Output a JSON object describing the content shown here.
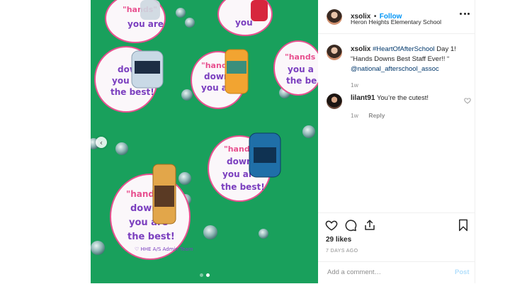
{
  "post": {
    "author": "xsolix",
    "follow_label": "Follow",
    "separator": "•",
    "location": "Heron Heights Elementary School",
    "caption": {
      "username": "xsolix",
      "hashtag": "#HeartOfAfterSchool",
      "text_1": "Day 1!",
      "text_2": "“Hands Downs Best Staff Ever!! “",
      "mention": "@national_afterschool_assoc",
      "time": "1w"
    },
    "comments": [
      {
        "username": "lilant91",
        "text": "You’re the cutest!",
        "time": "1w",
        "reply_label": "Reply"
      }
    ],
    "likes": "29 likes",
    "date": "7 DAYS AGO",
    "comment_placeholder": "Add a comment…",
    "post_label": "Post"
  },
  "carousel": {
    "current": 2,
    "total": 2
  },
  "photo": {
    "card_texts": [
      "\"hands\"",
      "down",
      "you are",
      "the best!"
    ],
    "card_signature": "♡ HHE A/S Admin Team"
  },
  "icons": [
    "chevron-left-icon",
    "more-icon",
    "heart-icon",
    "comment-icon",
    "share-icon",
    "bookmark-icon"
  ],
  "colors": {
    "link": "#0095f6",
    "hashtag": "#00376b",
    "muted": "#8e8e8e",
    "tablecloth": "#19a05c",
    "card_text": "#7b3fbf",
    "card_pink": "#e8508f"
  }
}
